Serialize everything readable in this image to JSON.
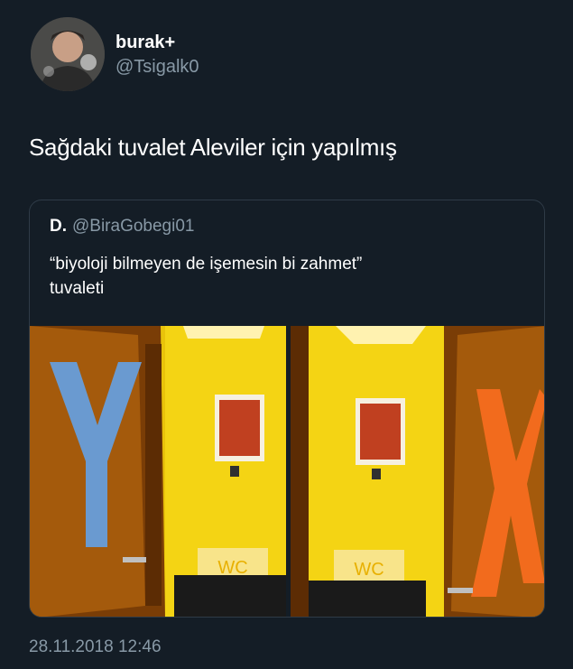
{
  "author": {
    "name": "burak+",
    "handle": "@Tsigalk0",
    "avatar_icon": "profile-photo"
  },
  "tweet": {
    "text": "Sağdaki tuvalet Aleviler için yapılmış",
    "timestamp": "28.11.2018 12:46"
  },
  "quote": {
    "name": "D.",
    "handle": "@BiraGobegi01",
    "text_line1": "“biyoloji bilmeyen de işemesin bi zahmet”",
    "text_line2": "tuvaleti",
    "images": [
      {
        "door_letter": "Y",
        "sign_text": "WC",
        "letter_color": "#6a9ad0"
      },
      {
        "door_letter": "X",
        "sign_text": "WC",
        "letter_color": "#f26b1d"
      }
    ]
  },
  "colors": {
    "background": "#141d26",
    "text_primary": "#ffffff",
    "text_secondary": "#8899a6",
    "card_border": "#2f3b47",
    "wall_yellow": "#f2d10a",
    "door_wood": "#a45a0c"
  }
}
